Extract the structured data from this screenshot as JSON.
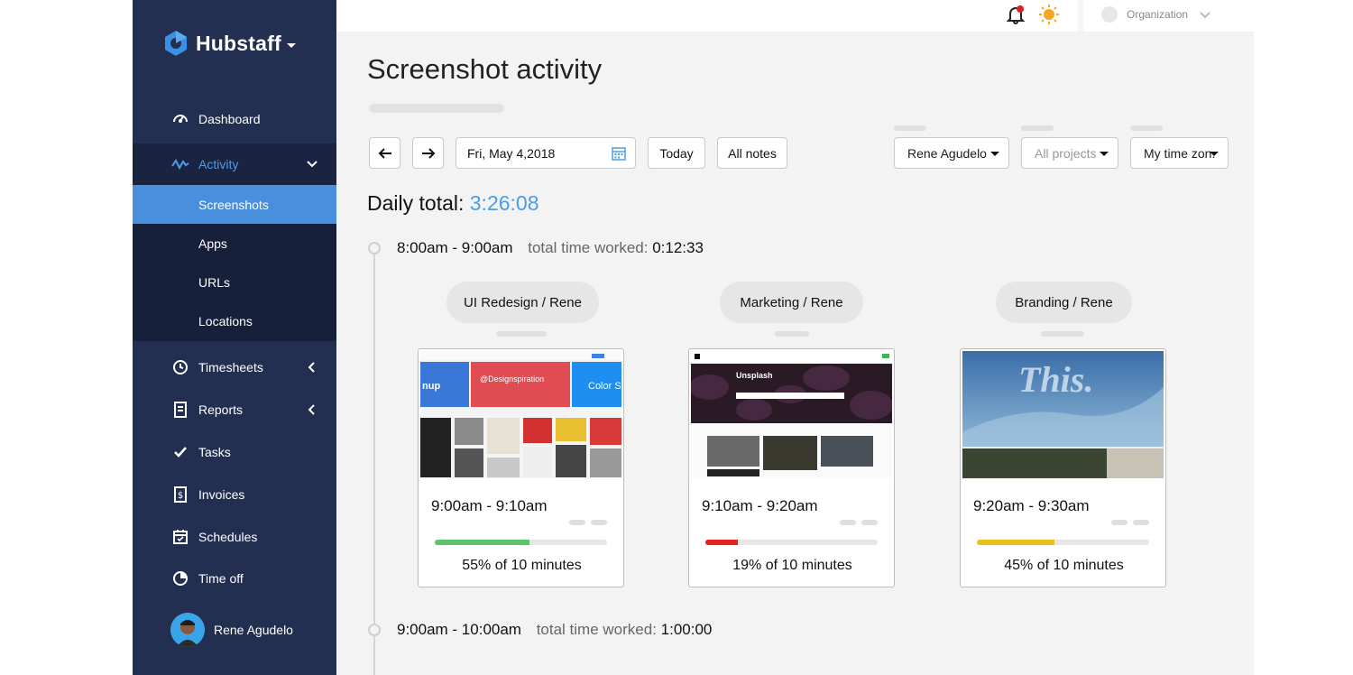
{
  "sidebar": {
    "brand": "Hubstaff",
    "items": {
      "dashboard": "Dashboard",
      "activity": "Activity",
      "screenshots": "Screenshots",
      "apps": "Apps",
      "urls": "URLs",
      "locations": "Locations",
      "timesheets": "Timesheets",
      "reports": "Reports",
      "tasks": "Tasks",
      "invoices": "Invoices",
      "schedules": "Schedules",
      "time_off": "Time off"
    },
    "user": "Rene Agudelo"
  },
  "topbar": {
    "organization": "Organization"
  },
  "main": {
    "title": "Screenshot activity",
    "date": "Fri, May 4,2018",
    "today_label": "Today",
    "notes_label": "All notes",
    "user_select": "Rene Agudelo",
    "project_select": "All projects",
    "timezone_select": "My time zon.",
    "daily_total_label": "Daily total:",
    "daily_total_value": "3:26:08",
    "hours": [
      {
        "range": "8:00am - 9:00am",
        "worked_label": "total time worked:",
        "worked_value": "0:12:33"
      },
      {
        "range": "9:00am - 10:00am",
        "worked_label": "total time worked:",
        "worked_value": "1:00:00"
      }
    ],
    "cards": [
      {
        "project": "UI Redesign / Rene",
        "time": "9:00am - 9:10am",
        "activity_percent": 55,
        "activity_label": "55% of 10 minutes",
        "color": "#5cc46c",
        "shot_text": "@Designspiration"
      },
      {
        "project": "Marketing / Rene",
        "time": "9:10am - 9:20am",
        "activity_percent": 19,
        "activity_label": "19% of 10 minutes",
        "color": "#e82020",
        "shot_text": "Unsplash"
      },
      {
        "project": "Branding / Rene",
        "time": "9:20am - 9:30am",
        "activity_percent": 45,
        "activity_label": "45% of 10 minutes",
        "color": "#e8c21a",
        "shot_text": "This."
      }
    ]
  },
  "colors": {
    "sidebar": "#232f50",
    "accent": "#4a9ee8",
    "active_item": "#4a8fde"
  }
}
